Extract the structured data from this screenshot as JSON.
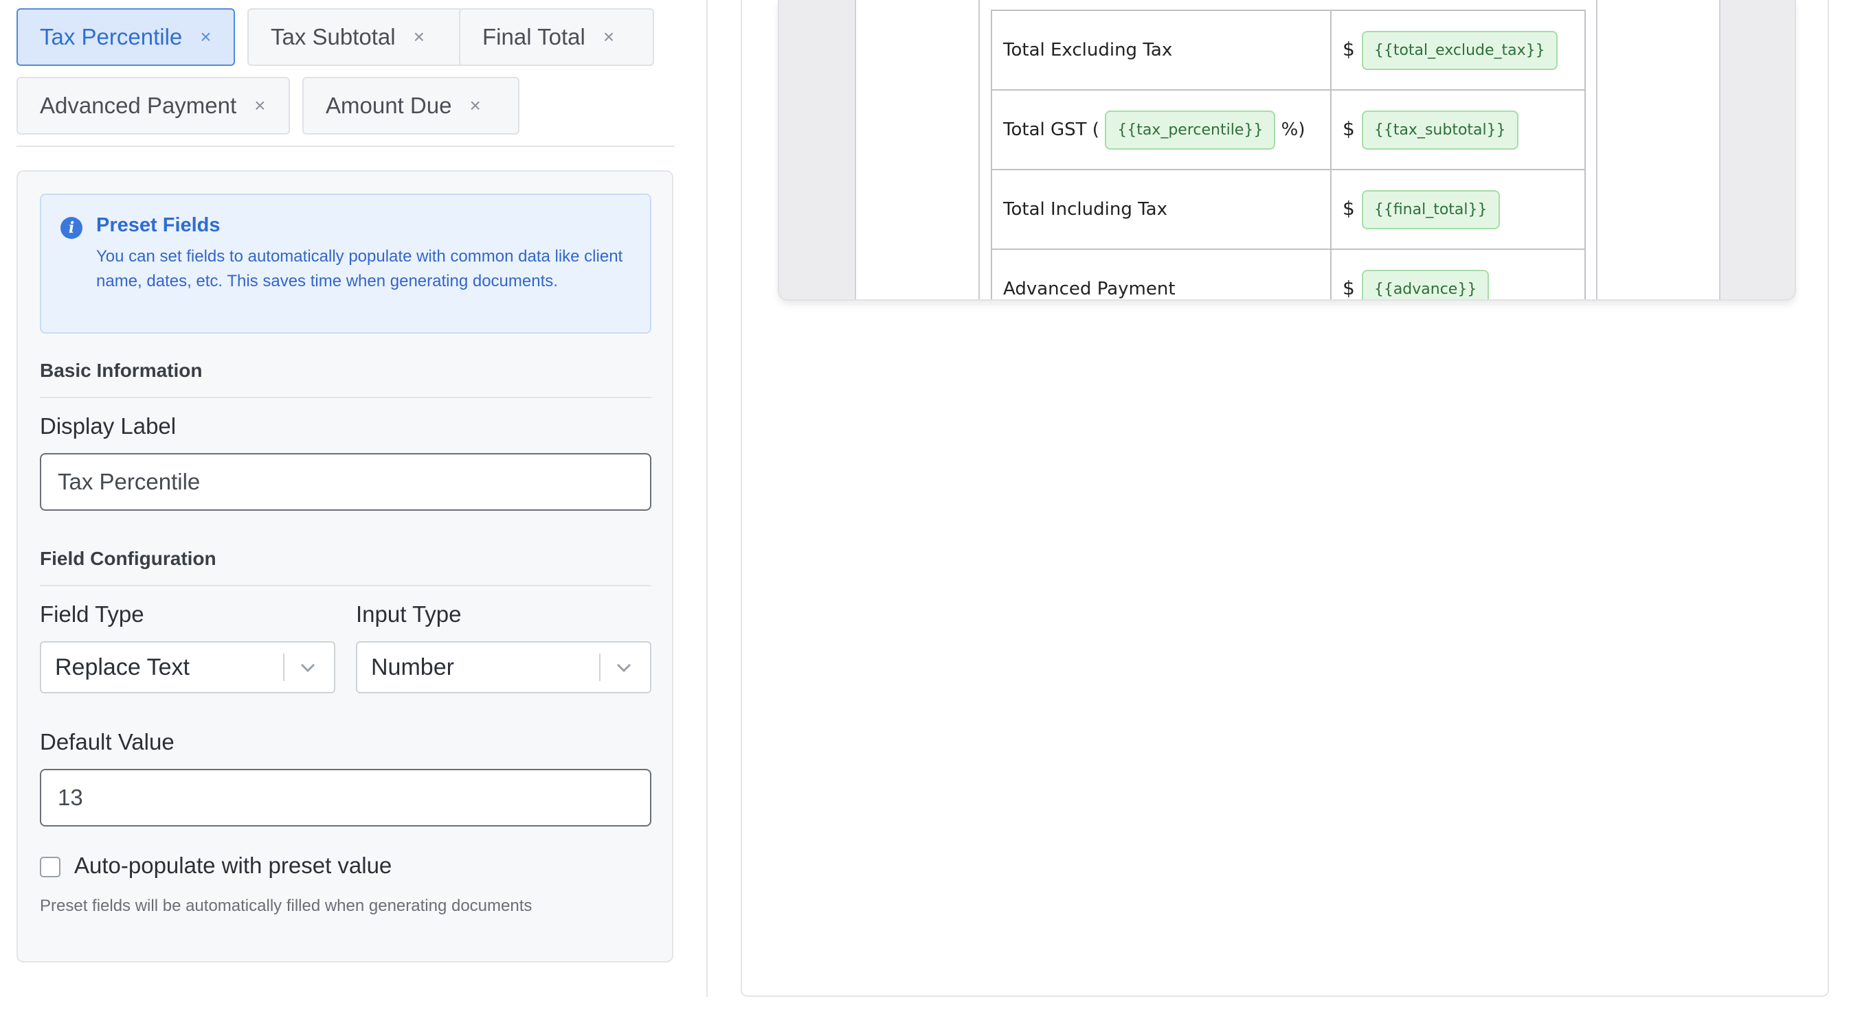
{
  "chips": [
    {
      "label": "Tax Percentile",
      "active": true
    },
    {
      "label": "Tax Subtotal",
      "active": false
    },
    {
      "label": "Final Total",
      "active": false
    },
    {
      "label": "Advanced Payment",
      "active": false
    },
    {
      "label": "Amount Due",
      "active": false
    }
  ],
  "chip_close_glyph": "×",
  "info": {
    "icon": "info-icon",
    "glyph": "i",
    "title": "Preset Fields",
    "text": "You can set fields to automatically populate with common data like client name, dates, etc. This saves time when generating documents."
  },
  "sections": {
    "basic": "Basic Information",
    "config": "Field Configuration"
  },
  "form": {
    "display_label_title": "Display Label",
    "display_label_value": "Tax Percentile",
    "field_type_title": "Field Type",
    "field_type_value": "Replace Text",
    "input_type_title": "Input Type",
    "input_type_value": "Number",
    "default_value_title": "Default Value",
    "default_value": "13",
    "auto_populate_label": "Auto-populate with preset value",
    "auto_populate_checked": false,
    "hint": "Preset fields will be automatically filled when generating documents"
  },
  "document": {
    "rows": [
      {
        "label": "Total Excluding Tax",
        "currency": "$",
        "tag": "{{total_exclude_tax}}"
      },
      {
        "label_prefix": "Total GST (",
        "inline_tag": "{{tax_percentile}}",
        "label_suffix": "%)",
        "currency": "$",
        "tag": "{{tax_subtotal}}"
      },
      {
        "label": "Total Including Tax",
        "currency": "$",
        "tag": "{{final_total}}"
      },
      {
        "label": "Advanced Payment",
        "currency": "$",
        "tag": "{{advance}}"
      }
    ]
  },
  "colors": {
    "accent": "#2f6fd1",
    "active_chip_bg": "#dbe8fb",
    "tag_bg": "#e3f6e4",
    "tag_text": "#2f6f38"
  }
}
